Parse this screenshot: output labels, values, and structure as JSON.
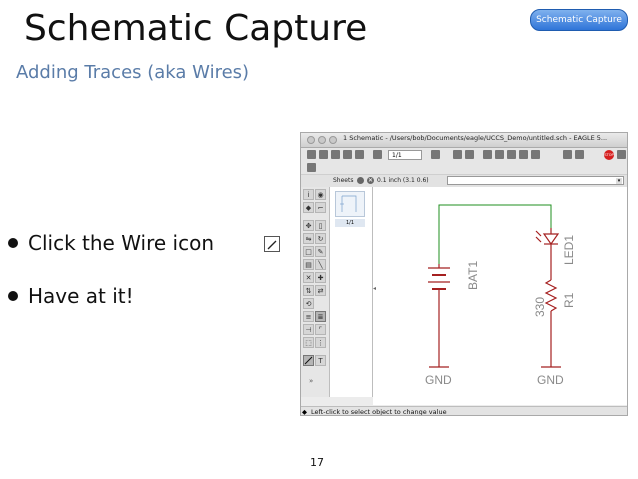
{
  "slide": {
    "title": "Schematic Capture",
    "subtitle": "Adding Traces (aka Wires)",
    "section_badge": "Schematic Capture",
    "bullets": [
      "Click the Wire icon",
      "Have at it!"
    ],
    "page_number": "17"
  },
  "window": {
    "title": "1 Schematic - /Users/bob/Documents/eagle/UCCS_Demo/untitled.sch - EAGLE 5...",
    "sheet_selector": "1/1",
    "stop_label": "STOP",
    "sheets_label": "Sheets",
    "grid_readout": "0.1 inch (3.1 0.6)",
    "command_input": "",
    "sheet_thumb_label": "1/1",
    "status_text": "Left-click to select object to change value"
  },
  "schematic": {
    "battery_label": "BAT1",
    "led_label": "LED1",
    "resistor_name": "R1",
    "resistor_value": "330",
    "gnd_left": "GND",
    "gnd_right": "GND",
    "wire_color": "#1f8f1f",
    "symbol_color": "#a52020"
  },
  "icons": {
    "wire": "wire-icon",
    "info": "info-icon",
    "show": "eye-icon",
    "move": "move-icon",
    "rotate": "rotate-icon",
    "delete": "delete-icon",
    "text": "text-icon"
  }
}
